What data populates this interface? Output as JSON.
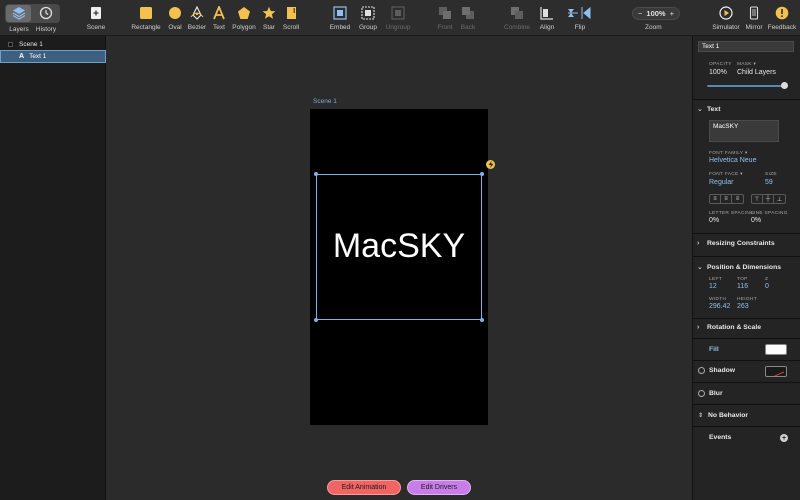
{
  "toolbar": {
    "layers_label": "Layers",
    "history_label": "History",
    "scene_label": "Scene",
    "rectangle_label": "Rectangle",
    "oval_label": "Oval",
    "bezier_label": "Bezier",
    "text_label": "Text",
    "polygon_label": "Polygon",
    "star_label": "Star",
    "scroll_label": "Scroll",
    "embed_label": "Embed",
    "group_label": "Group",
    "ungroup_label": "Ungroup",
    "front_label": "Front",
    "back_label": "Back",
    "combine_label": "Combine",
    "align_label": "Align",
    "flip_label": "Flip",
    "zoom_label": "Zoom",
    "zoom_value": "100%",
    "zoom_minus": "−",
    "zoom_plus": "+",
    "simulator_label": "Simulator",
    "mirror_label": "Mirror",
    "feedback_label": "Feedback",
    "accent_color": "#f2c14e"
  },
  "layers": {
    "scene_name": "Scene 1",
    "text_layer_icon": "A",
    "text_layer_name": "Text 1"
  },
  "canvas": {
    "scene_label": "Scene 1",
    "text_content": "MacSKY",
    "edit_animation_label": "Edit Animation",
    "edit_drivers_label": "Edit Drivers"
  },
  "inspector": {
    "layer_name": "Text 1",
    "opacity_caption": "OPACITY",
    "opacity_value": "100%",
    "mask_caption": "MASK ▾",
    "mask_value": "Child Layers",
    "opacity_level": 1.0,
    "text_section": "Text",
    "text_value": "MacSKY",
    "font_family_caption": "FONT FAMILY ▾",
    "font_family_value": "Helvetica Neue",
    "font_face_caption": "FONT FACE ▾",
    "font_face_value": "Regular",
    "size_caption": "SIZE",
    "size_value": "59",
    "letter_spacing_caption": "LETTER SPACING",
    "letter_spacing_value": "0%",
    "line_spacing_caption": "LINE SPACING",
    "line_spacing_value": "0%",
    "resizing_section": "Resizing Constraints",
    "position_section": "Position & Dimensions",
    "left_caption": "LEFT",
    "left_value": "12",
    "top_caption": "TOP",
    "top_value": "116",
    "z_caption": "Z",
    "z_value": "0",
    "width_caption": "WIDTH",
    "width_value": "296.42",
    "height_caption": "HEIGHT",
    "height_value": "263",
    "rotation_section": "Rotation & Scale",
    "fill_label": "Fill",
    "fill_color": "#ffffff",
    "shadow_label": "Shadow",
    "blur_label": "Blur",
    "behavior_label": "No Behavior",
    "events_label": "Events"
  }
}
